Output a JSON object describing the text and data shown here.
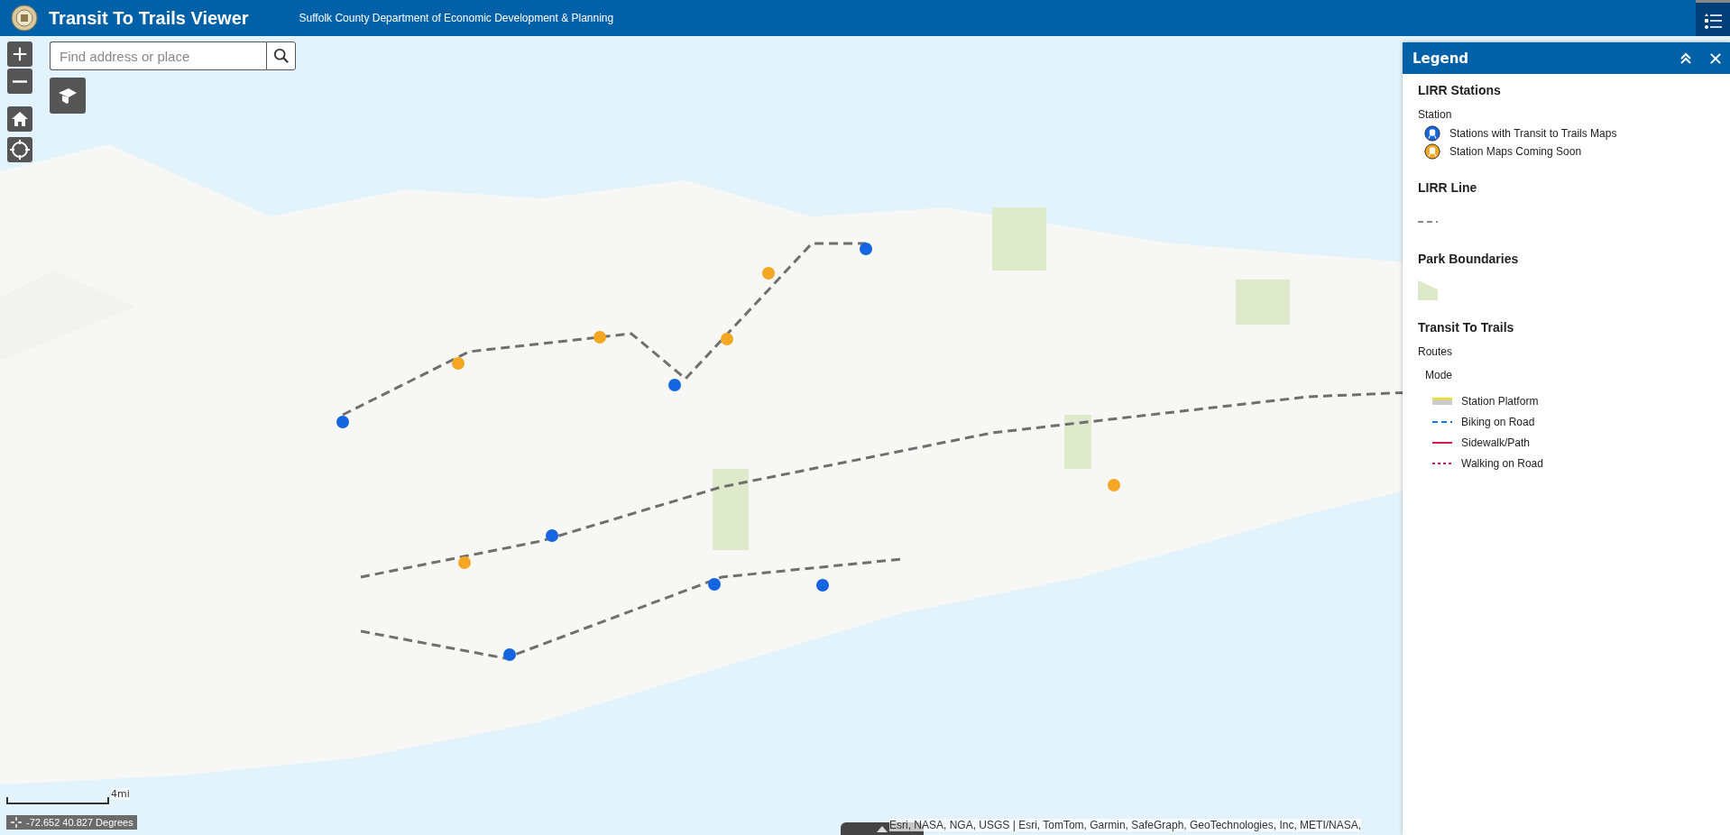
{
  "header": {
    "title": "Transit To Trails Viewer",
    "subtitle": "Suffolk County Department of Economic Development & Planning"
  },
  "search": {
    "placeholder": "Find address or place"
  },
  "legend": {
    "title": "Legend",
    "sections": [
      {
        "title": "LIRR Stations",
        "caption": "Station",
        "items": [
          {
            "kind": "station",
            "label": "Stations with Transit to Trails Maps",
            "color": "#1565e0"
          },
          {
            "kind": "station",
            "label": "Station Maps Coming Soon",
            "color": "#f5a623"
          }
        ]
      },
      {
        "title": "LIRR Line",
        "items": [
          {
            "kind": "dashed",
            "color": "#8a8a8a"
          }
        ]
      },
      {
        "title": "Park Boundaries",
        "items": [
          {
            "kind": "park",
            "color": "#dde8c8"
          }
        ]
      },
      {
        "title": "Transit To Trails",
        "caption": "Routes",
        "subcaption": "Mode",
        "items": [
          {
            "kind": "platform",
            "label": "Station Platform",
            "color": "#cccccc"
          },
          {
            "kind": "dashed",
            "label": "Biking on Road",
            "color": "#1a73e8"
          },
          {
            "kind": "solid",
            "label": "Sidewalk/Path",
            "color": "#d81b50"
          },
          {
            "kind": "dotted",
            "label": "Walking on Road",
            "color": "#d81b50"
          }
        ]
      }
    ]
  },
  "scale": "4mi",
  "coordinates": "-72.652 40.827 Degrees",
  "attribution": "Esri, NASA, NGA, USGS | Esri, TomTom, Garmin, SafeGraph, GeoTechnologies, Inc, METI/NASA,"
}
